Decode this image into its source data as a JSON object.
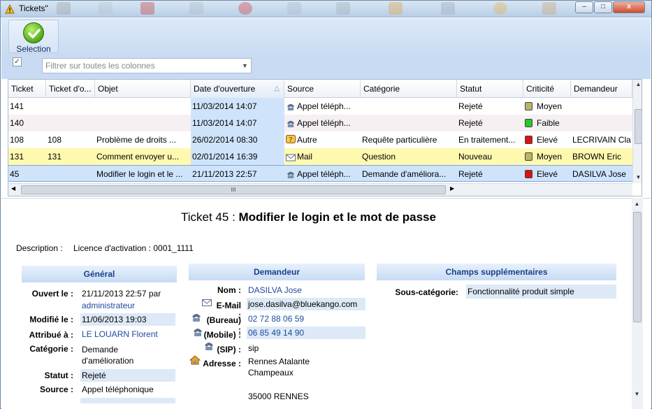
{
  "window": {
    "title": "Tickets\"",
    "minimize": "–",
    "maximize": "□",
    "close": "x"
  },
  "toolbar": {
    "selection_label": "Selection"
  },
  "filter": {
    "checked": true,
    "placeholder": "Filtrer sur toutes les colonnes"
  },
  "grid": {
    "columns": [
      "Ticket",
      "Ticket d'o...",
      "Objet",
      "Date d'ouverture",
      "Source",
      "Catégorie",
      "Statut",
      "Criticité",
      "Demandeur"
    ],
    "rows": [
      {
        "ticket": "141",
        "ticket_o": "",
        "objet": "",
        "date": "11/03/2014 14:07",
        "source": "Appel téléph...",
        "source_icon": "phone-icon",
        "categorie": "",
        "statut": "Rejeté",
        "criticite": "Moyen",
        "crit_color": "#b9b46a",
        "demandeur": "",
        "bg": "#ffffff"
      },
      {
        "ticket": "140",
        "ticket_o": "",
        "objet": "",
        "date": "11/03/2014 14:07",
        "source": "Appel téléph...",
        "source_icon": "phone-icon",
        "categorie": "",
        "statut": "Rejeté",
        "criticite": "Faible",
        "crit_color": "#22cc22",
        "demandeur": "",
        "bg": "#f6f0f2"
      },
      {
        "ticket": "108",
        "ticket_o": "108",
        "objet": "Problème de droits ...",
        "date": "26/02/2014 08:30",
        "source": "Autre",
        "source_icon": "question-icon",
        "categorie": "Requête particulière",
        "statut": "En traitement...",
        "criticite": "Elevé",
        "crit_color": "#dd1111",
        "demandeur": "LECRIVAIN Cla",
        "bg": "#ffffff"
      },
      {
        "ticket": "131",
        "ticket_o": "131",
        "objet": "Comment envoyer u...",
        "date": "02/01/2014 16:39",
        "source": "Mail",
        "source_icon": "mail-icon",
        "categorie": "Question",
        "statut": "Nouveau",
        "criticite": "Moyen",
        "crit_color": "#b9b46a",
        "demandeur": "BROWN Eric",
        "bg": "#fff9b0"
      },
      {
        "ticket": "45",
        "ticket_o": "",
        "objet": "Modifier le login et le ...",
        "date": "21/11/2013 22:57",
        "source": "Appel téléph...",
        "source_icon": "phone-icon",
        "categorie": "Demande d'améliora...",
        "statut": "Rejeté",
        "criticite": "Elevé",
        "crit_color": "#dd1111",
        "demandeur": "DASILVA Jose",
        "bg": "#cfe4fb",
        "selected": true
      }
    ],
    "hscroll_grip": "III"
  },
  "detail": {
    "title_prefix": "Ticket 45 : ",
    "title_bold": "Modifier le login et le mot de passe",
    "description_label": "Description :",
    "description_value": "Licence d'activation : 0001_1111",
    "general": {
      "header": "Général",
      "ouvert_label": "Ouvert le :",
      "ouvert_value": "21/11/2013 22:57 par",
      "ouvert_user": "administrateur",
      "modifie_label": "Modifié le :",
      "modifie_value": "11/06/2013 19:03",
      "attribue_label": "Attribué à :",
      "attribue_value": "LE LOUARN Florent",
      "categorie_label": "Catégorie :",
      "categorie_value_1": "Demande",
      "categorie_value_2": "d'amélioration",
      "statut_label": "Statut :",
      "statut_value": "Rejeté",
      "source_label": "Source :",
      "source_value": "Appel téléphonique"
    },
    "demandeur": {
      "header": "Demandeur",
      "nom_label": "Nom :",
      "nom_value": "DASILVA Jose",
      "email_label": "E-Mail :",
      "email_value": "jose.dasilva@bluekango.com",
      "bureau_label": "(Bureau) :",
      "bureau_value": "02 72 88 06 59",
      "mobile_label": "(Mobile) :",
      "mobile_value": "06 85 49 14 90",
      "sip_label": "(SIP) :",
      "sip_value": "sip",
      "adresse_label": "Adresse :",
      "adresse_1": "Rennes Atalante",
      "adresse_2": "Champeaux",
      "adresse_3": "35000 RENNES"
    },
    "supp": {
      "header": "Champs supplémentaires",
      "souscat_label": "Sous-catégorie:",
      "souscat_value": "Fonctionnalité produit simple"
    }
  }
}
